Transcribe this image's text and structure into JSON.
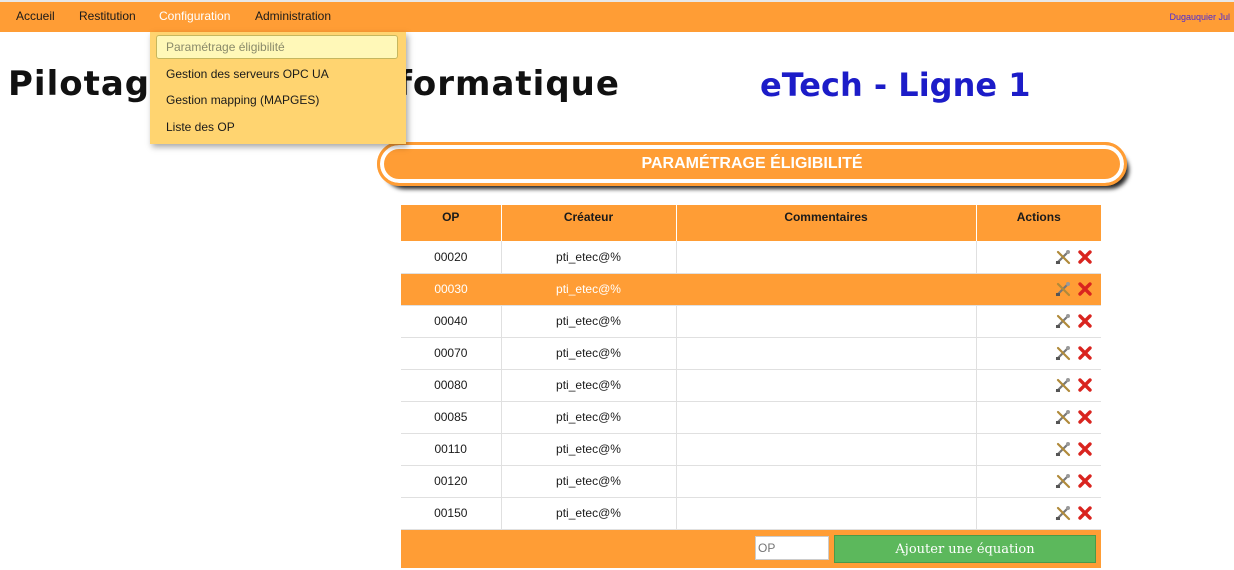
{
  "nav": {
    "items": [
      {
        "label": "Accueil"
      },
      {
        "label": "Restitution"
      },
      {
        "label": "Configuration"
      },
      {
        "label": "Administration"
      }
    ],
    "user": "Dugauquier Jul"
  },
  "dropdown": {
    "items": [
      {
        "label": "Paramétrage éligibilité"
      },
      {
        "label": "Gestion des serveurs OPC UA"
      },
      {
        "label": "Gestion mapping (MAPGES)"
      },
      {
        "label": "Liste des OP"
      }
    ]
  },
  "heading": {
    "left": "Pilotag",
    "right": "té Informatique",
    "brand": "eTech - Ligne 1"
  },
  "section": {
    "title": "PARAMÉTRAGE ÉLIGIBILITÉ"
  },
  "table": {
    "headers": {
      "op": "OP",
      "creator": "Créateur",
      "comments": "Commentaires",
      "actions": "Actions"
    },
    "rows": [
      {
        "op": "00020",
        "creator": "pti_etec@%",
        "comment": ""
      },
      {
        "op": "00030",
        "creator": "pti_etec@%",
        "comment": ""
      },
      {
        "op": "00040",
        "creator": "pti_etec@%",
        "comment": ""
      },
      {
        "op": "00070",
        "creator": "pti_etec@%",
        "comment": ""
      },
      {
        "op": "00080",
        "creator": "pti_etec@%",
        "comment": ""
      },
      {
        "op": "00085",
        "creator": "pti_etec@%",
        "comment": ""
      },
      {
        "op": "00110",
        "creator": "pti_etec@%",
        "comment": ""
      },
      {
        "op": "00120",
        "creator": "pti_etec@%",
        "comment": ""
      },
      {
        "op": "00150",
        "creator": "pti_etec@%",
        "comment": ""
      }
    ],
    "highlighted_row": 1
  },
  "footer": {
    "op_placeholder": "OP",
    "add_button": "Ajouter une équation"
  },
  "colors": {
    "accent": "#ff9d35",
    "dropdown_bg": "#ffd470",
    "brand_blue": "#1c1cc8",
    "delete_red": "#d9241f",
    "add_green": "#5cb85c"
  },
  "icons": {
    "edit": "edit-tools-icon",
    "delete": "delete-x-icon"
  }
}
